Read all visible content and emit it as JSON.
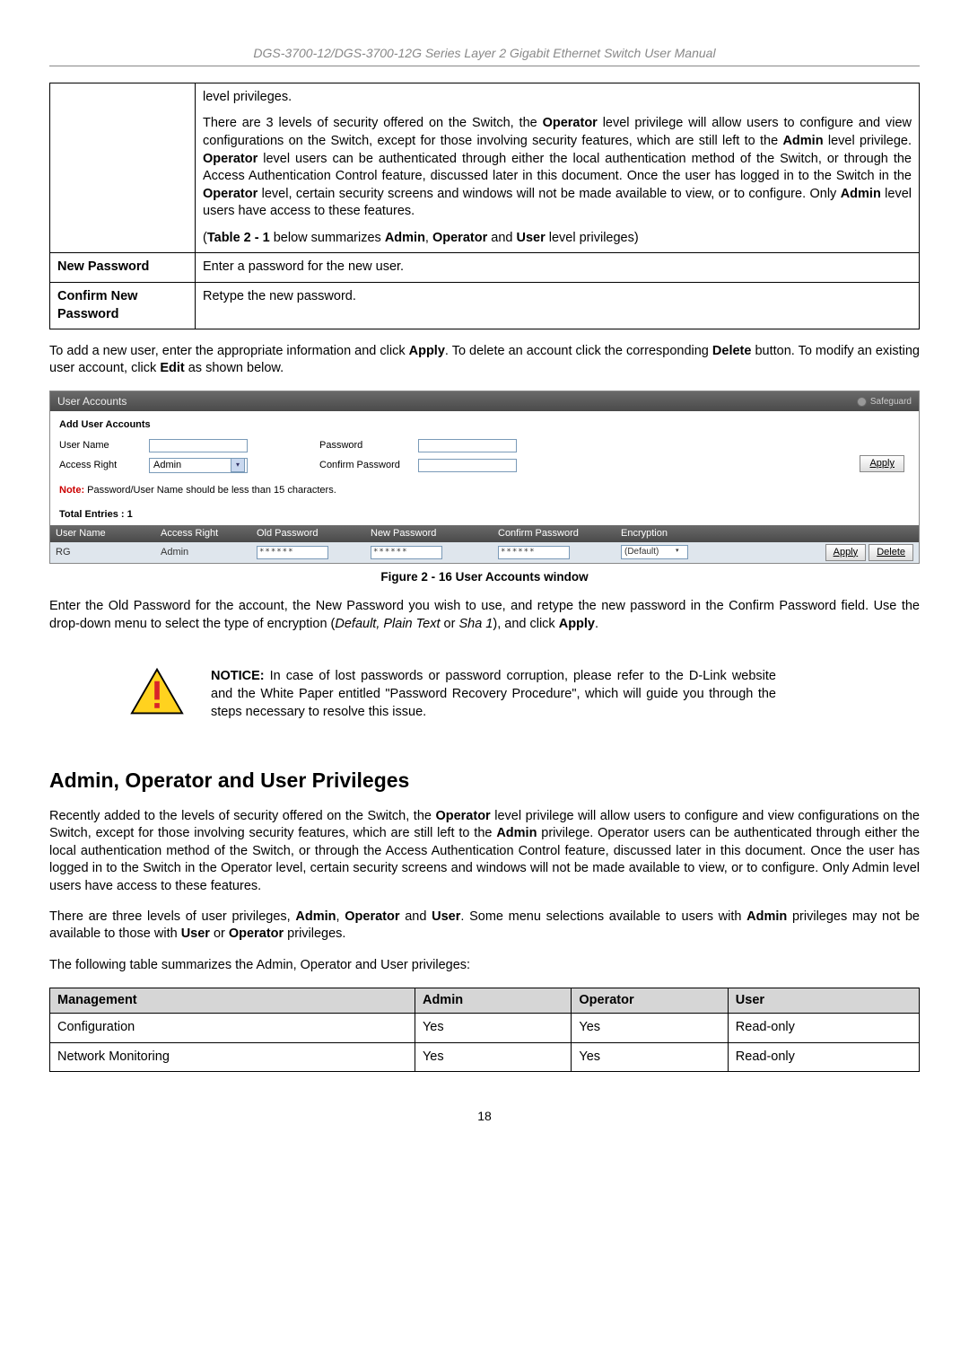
{
  "header": "DGS-3700-12/DGS-3700-12G Series Layer 2 Gigabit Ethernet Switch User Manual",
  "tbl": {
    "r1a": "level privileges.",
    "r1b_pre": "There are 3 levels of security offered on the Switch, the ",
    "r1b_op": "Operator",
    "r1b_mid1": " level privilege will allow users to configure and view configurations on the Switch, except for those involving security features, which are still left to the ",
    "r1b_admin1": "Admin",
    "r1b_mid2": " level privilege. ",
    "r1b_op2": "Operator",
    "r1b_mid3": " level users can be authenticated through either the local authentication method of the Switch, or through the Access Authentication Control feature, discussed later in this document. Once the user has logged in to the Switch in the ",
    "r1b_op3": "Operator",
    "r1b_mid4": " level, certain security screens and windows will not be made available to view, or to configure. Only ",
    "r1b_admin2": "Admin",
    "r1b_end": " level users have access to these features.",
    "r1c_open": "(",
    "r1c_tbl": "Table 2 - 1",
    "r1c_mid": " below summarizes ",
    "r1c_a": "Admin",
    "r1c_c1": ", ",
    "r1c_o": "Operator",
    "r1c_c2": " and ",
    "r1c_u": "User",
    "r1c_end": " level privileges)",
    "r2_label": "New Password",
    "r2_desc": "Enter a password for the new user.",
    "r3_label": "Confirm New Password",
    "r3_desc": "Retype the new password."
  },
  "addnew_pre": "To add a new user, enter the appropriate information and click ",
  "addnew_apply": "Apply",
  "addnew_mid": ". To delete an account click the corresponding ",
  "addnew_del": "Delete",
  "addnew_mid2": " button. To modify an existing user account, click ",
  "addnew_edit": "Edit",
  "addnew_end": " as shown below.",
  "scr": {
    "title": "User Accounts",
    "safeguard": "Safeguard",
    "section": "Add User Accounts",
    "username_lbl": "User Name",
    "access_lbl": "Access Right",
    "access_val": "Admin",
    "password_lbl": "Password",
    "confirm_lbl": "Confirm Password",
    "apply_btn": "Apply",
    "note_b": "Note:",
    "note_txt": " Password/User Name should be less than 15 characters.",
    "total": "Total Entries : 1",
    "hdr_un": "User Name",
    "hdr_ar": "Access Right",
    "hdr_op": "Old Password",
    "hdr_np": "New Password",
    "hdr_cp": "Confirm Password",
    "hdr_en": "Encryption",
    "row_un": "RG",
    "row_ar": "Admin",
    "row_mask": "******",
    "row_enc": "(Default)",
    "row_apply": "Apply",
    "row_delete": "Delete"
  },
  "fig_caption": "Figure 2 - 16 User Accounts window",
  "p2_pre": "Enter the Old Password for the account, the New Password you wish to use, and retype the new password in the Confirm Password field. Use the drop-down menu to select the type of encryption (",
  "p2_i1": "Default, Plain Text",
  "p2_mid": " or ",
  "p2_i2": "Sha 1",
  "p2_mid2": "), and click ",
  "p2_apply": "Apply",
  "p2_end": ".",
  "notice_b": "NOTICE:",
  "notice_txt": " In case of lost passwords or password corruption, please refer to the D-Link website and the White Paper entitled \"Password Recovery Procedure\", which will guide you through the steps necessary to resolve this issue.",
  "h2": "Admin, Operator and User Privileges",
  "p3_pre": "Recently added to the levels of security offered on the Switch, the ",
  "p3_op": "Operator",
  "p3_mid1": " level privilege will allow users to configure and view configurations on the Switch, except for those involving security features, which are still left to the ",
  "p3_admin": "Admin",
  "p3_end": " privilege. Operator users can be authenticated through either the local authentication method of the Switch, or through the Access Authentication Control feature, discussed later in this document. Once the user has logged in to the Switch in the Operator level, certain security screens and windows will not be made available to view, or to configure. Only Admin level users have access to these features.",
  "p4_pre": "There are three levels of user privileges, ",
  "p4_a": "Admin",
  "p4_c1": ", ",
  "p4_o": "Operator",
  "p4_c2": " and ",
  "p4_u": "User",
  "p4_mid": ". Some menu selections available to users with ",
  "p4_a2": "Admin",
  "p4_mid2": " privileges may not be available to those with ",
  "p4_u2": "User",
  "p4_c3": " or ",
  "p4_o2": "Operator",
  "p4_end": " privileges.",
  "p5": "The following table summarizes the Admin, Operator and User privileges:",
  "priv": {
    "h_mgmt": "Management",
    "h_admin": "Admin",
    "h_op": "Operator",
    "h_user": "User",
    "r1_0": "Configuration",
    "r1_1": "Yes",
    "r1_2": "Yes",
    "r1_3": "Read-only",
    "r2_0": "Network Monitoring",
    "r2_1": "Yes",
    "r2_2": "Yes",
    "r2_3": "Read-only"
  },
  "page_num": "18"
}
